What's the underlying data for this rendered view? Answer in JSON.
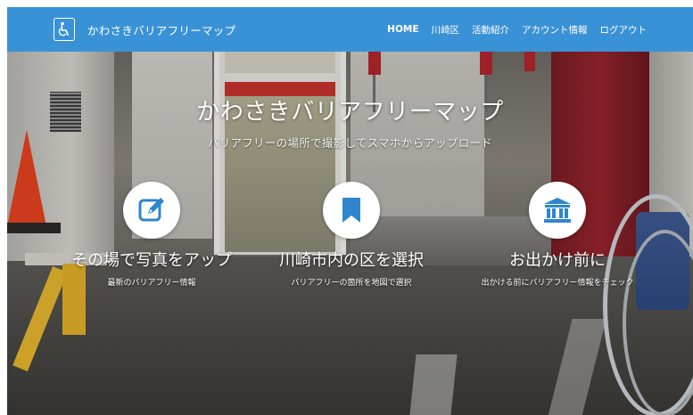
{
  "brand": {
    "title": "かわさきバリアフリーマップ",
    "logo_icon": "wheelchair-icon"
  },
  "nav": {
    "items": [
      "HOME",
      "川崎区",
      "活動紹介",
      "アカウント情報",
      "ログアウト"
    ]
  },
  "hero": {
    "title": "かわさきバリアフリーマップ",
    "subtitle": "バリアフリーの場所で撮影してスマホからアップロード"
  },
  "features": [
    {
      "icon": "pencil-square-icon",
      "title": "その場で写真をアップ",
      "desc": "最新のバリアフリー情報"
    },
    {
      "icon": "bookmark-icon",
      "title": "川崎市内の区を選択",
      "desc": "バリアフリーの箇所を地図で選択"
    },
    {
      "icon": "bank-building-icon",
      "title": "お出かけ前に",
      "desc": "出かける前にバリアフリー情報をチェック"
    }
  ],
  "colors": {
    "navbar": "#3a92d6",
    "icon_blue": "#2f86cc",
    "text": "#ffffff"
  }
}
